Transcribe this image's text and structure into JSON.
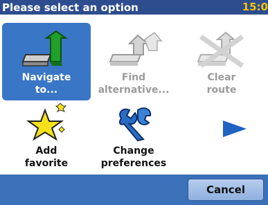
{
  "titlebar": {
    "title": "Please select an option",
    "time": "15:0"
  },
  "menu": {
    "items": [
      {
        "label_line1": "Navigate",
        "label_line2": "to...",
        "state": "selected"
      },
      {
        "label_line1": "Find",
        "label_line2": "alternative...",
        "state": "disabled"
      },
      {
        "label_line1": "Clear",
        "label_line2": "route",
        "state": "disabled"
      },
      {
        "label_line1": "Add",
        "label_line2": "favorite",
        "state": "normal"
      },
      {
        "label_line1": "Change",
        "label_line2": "preferences",
        "state": "normal"
      }
    ],
    "next_icon": "next-page-arrow-icon"
  },
  "bottombar": {
    "cancel_label": "Cancel"
  },
  "colors": {
    "titlebar": "#2e4d8f",
    "clock": "#f6c400",
    "selected_tile": "#3a76c6",
    "bottombar": "#3b71b8",
    "disabled_text": "#9b9b9b"
  }
}
